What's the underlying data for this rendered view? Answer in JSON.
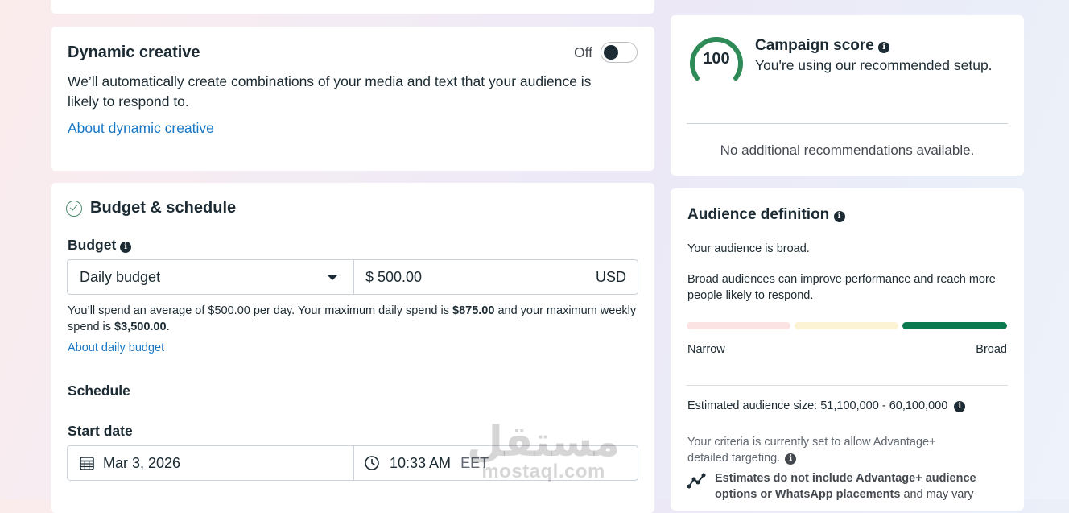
{
  "dynamic_creative": {
    "title": "Dynamic creative",
    "toggle_label": "Off",
    "description": "We’ll automatically create combinations of your media and text that your audience is likely to respond to.",
    "about_link": "About dynamic creative"
  },
  "budget_schedule": {
    "title": "Budget & schedule",
    "budget_label": "Budget",
    "budget_type": "Daily budget",
    "amount": "$ 500.00",
    "currency": "USD",
    "help": {
      "part1": "You’ll spend an average of $500.00 per day. Your maximum daily spend is ",
      "daily_max": "$875.00",
      "part2": " and your maximum weekly spend is ",
      "weekly_max": "$3,500.00",
      "part3": "."
    },
    "about_link": "About daily budget",
    "schedule_label": "Schedule",
    "start_date_label": "Start date",
    "start_date": "Mar 3, 2026",
    "start_time": "10:33 AM",
    "timezone": "EET"
  },
  "campaign_score": {
    "score": "100",
    "title": "Campaign score",
    "subtitle": "You're using our recommended setup.",
    "no_recommendations": "No additional recommendations available.",
    "gauge_color": "#2e8b57"
  },
  "audience": {
    "title": "Audience definition",
    "status": "Your audience is broad.",
    "explanation": "Broad audiences can improve performance and reach more people likely to respond.",
    "scale_left": "Narrow",
    "scale_right": "Broad",
    "level": "broad",
    "bar_colors": [
      "#fbe3e3",
      "#fbf3d3",
      "#0b7a4e"
    ],
    "size_label": "Estimated audience size:",
    "size_value": "51,100,000 - 60,100,000",
    "criteria": "Your criteria is currently set to allow Advantage+ detailed targeting.",
    "note_bold": "Estimates do not include Advantage+ audience options or WhatsApp placements",
    "note_rest": " and may vary"
  },
  "watermark": {
    "arabic": "مستقل",
    "latin": "mostaql.com"
  }
}
